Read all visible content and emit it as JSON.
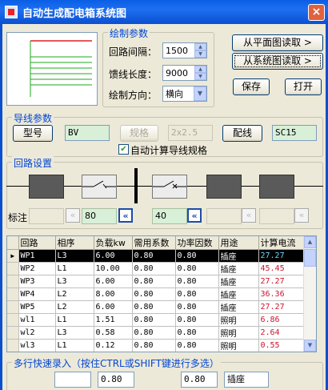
{
  "window": {
    "title": "自动生成配电箱系统图",
    "close_label": "×"
  },
  "draw_params": {
    "title": "绘制参数",
    "circuit_spacing_label": "回路间隔：",
    "circuit_spacing_value": "1500",
    "feeder_length_label": "馈线长度：",
    "feeder_length_value": "9000",
    "draw_direction_label": "绘制方向：",
    "draw_direction_value": "横向"
  },
  "buttons": {
    "read_from_plan": "从平面图读取 >",
    "read_from_system": "从系统图读取 >",
    "save": "保存",
    "open": "打开",
    "model": "型号",
    "spec": "规格",
    "wiring": "配线"
  },
  "wire_params": {
    "title": "导线参数",
    "model_value": "BV",
    "spec_value": "2x2.5",
    "conduit_value": "SC15",
    "auto_calc_label": "自动计算导线规格",
    "auto_calc_checked": true
  },
  "circuit_settings": {
    "title": "回路设置",
    "annotation_label": "标注",
    "field1": "",
    "field2": "80",
    "field3": "40",
    "field4": "",
    "field5": ""
  },
  "grid": {
    "columns": [
      "回路",
      "相序",
      "负载kw",
      "需用系数",
      "功率因数",
      "用途",
      "计算电流"
    ],
    "rows": [
      [
        "WP1",
        "L3",
        "6.00",
        "0.80",
        "0.80",
        "插座",
        "27.27"
      ],
      [
        "WP2",
        "L1",
        "10.00",
        "0.80",
        "0.80",
        "插座",
        "45.45"
      ],
      [
        "WP3",
        "L3",
        "6.00",
        "0.80",
        "0.80",
        "插座",
        "27.27"
      ],
      [
        "WP4",
        "L2",
        "8.00",
        "0.80",
        "0.80",
        "插座",
        "36.36"
      ],
      [
        "WP5",
        "L2",
        "6.00",
        "0.80",
        "0.80",
        "插座",
        "27.27"
      ],
      [
        "wl1",
        "L1",
        "1.51",
        "0.80",
        "0.80",
        "照明",
        "6.86"
      ],
      [
        "wl2",
        "L3",
        "0.58",
        "0.80",
        "0.80",
        "照明",
        "2.64"
      ],
      [
        "wl3",
        "L1",
        "0.12",
        "0.80",
        "0.80",
        "照明",
        "0.55"
      ]
    ],
    "selected_index": 0
  },
  "quick_entry": {
    "title": "多行快速录入（按住CTRL或SHIFT键进行多选）",
    "field_values": [
      "",
      "0.80",
      "0.80",
      "插座"
    ]
  },
  "colors": {
    "accent": "#0046d5",
    "current_text": "#d0142c",
    "selected_current_text": "#6dd6ff",
    "wire_red": "#e02020",
    "wire_green": "#1ea91e"
  }
}
